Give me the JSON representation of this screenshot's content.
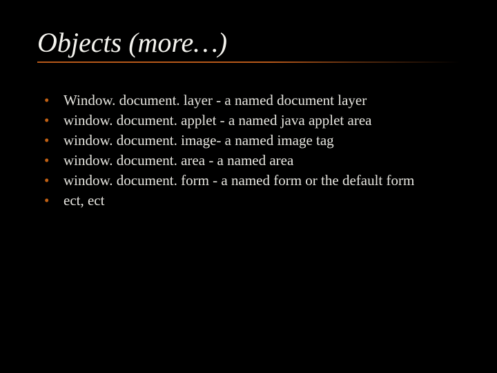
{
  "title": "Objects (more…)",
  "items": [
    "Window. document. layer - a named document layer",
    "window. document. applet - a named java applet area",
    "window. document. image- a named image tag",
    "window. document. area - a named area",
    "window. document. form - a named form or the default form",
    "ect, ect"
  ]
}
